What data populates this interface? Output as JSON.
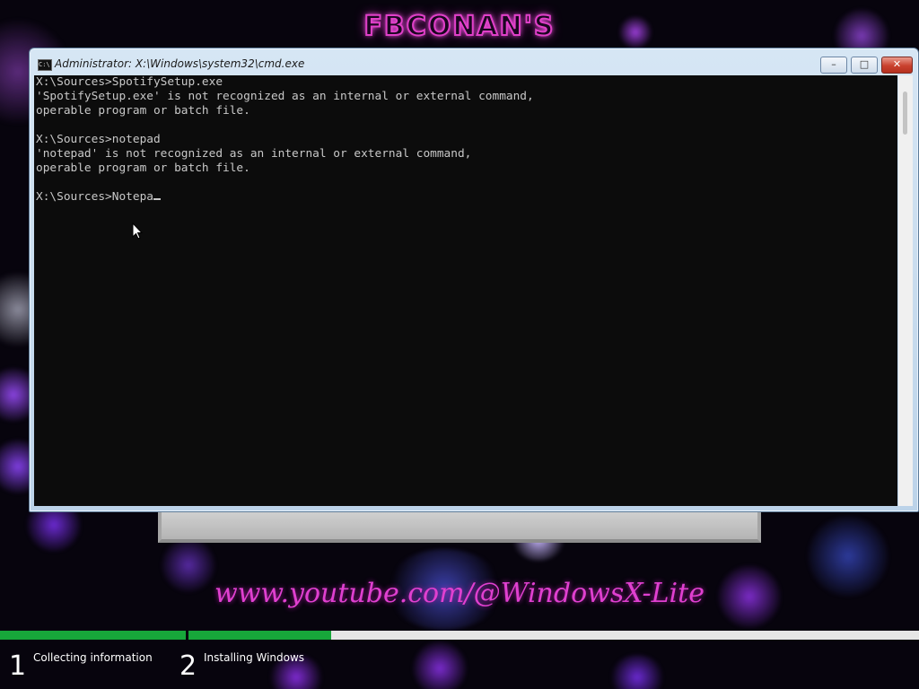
{
  "branding": {
    "title": "FBCONAN'S",
    "url": "www.youtube.com/@WindowsX-Lite"
  },
  "window": {
    "title": "Administrator: X:\\Windows\\system32\\cmd.exe",
    "icon": "cmd-icon",
    "buttons": {
      "minimize": "–",
      "maximize": "□",
      "close": "✕"
    }
  },
  "console": {
    "lines": [
      "X:\\Sources>SpotifySetup.exe",
      "'SpotifySetup.exe' is not recognized as an internal or external command,",
      "operable program or batch file.",
      "",
      "X:\\Sources>notepad",
      "'notepad' is not recognized as an internal or external command,",
      "operable program or batch file.",
      "",
      "X:\\Sources>Notepa"
    ]
  },
  "setup": {
    "steps": [
      {
        "number": "1",
        "label": "Collecting information",
        "progress": 1.0
      },
      {
        "number": "2",
        "label": "Installing Windows",
        "progress": 0.195
      }
    ]
  },
  "colors": {
    "console_bg": "#0c0c0c",
    "console_text": "#c8c8c8",
    "progress_green": "#17a73a",
    "accent_pink": "#e040d0"
  }
}
